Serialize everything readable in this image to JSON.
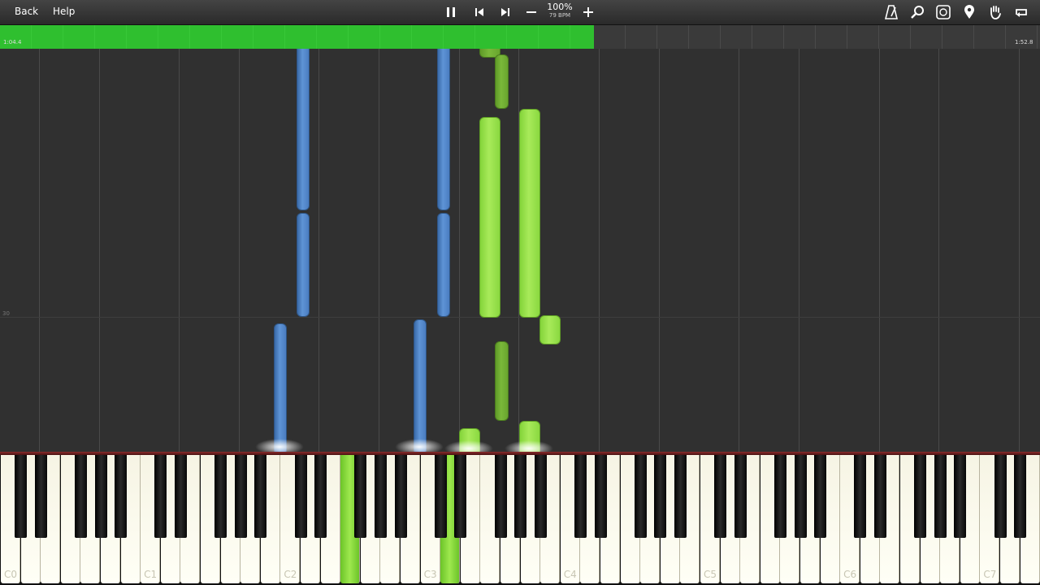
{
  "toolbar": {
    "back_label": "Back",
    "help_label": "Help",
    "zoom": "100%",
    "tempo": "79 BPM",
    "icons": [
      "pause-icon",
      "skip-back-icon",
      "skip-forward-icon",
      "minus-icon",
      "plus-icon",
      "metronome-icon",
      "search-icon",
      "label-icon",
      "location-icon",
      "hand-icon",
      "loop-icon"
    ]
  },
  "progress": {
    "elapsed": "1:04.4",
    "total": "1:52.8",
    "played_fraction": 0.571
  },
  "roll": {
    "measure_label": "30"
  },
  "keyboard": {
    "octave_labels": [
      "C0",
      "C1",
      "C2",
      "C3",
      "C4",
      "C5",
      "C6",
      "C7"
    ]
  },
  "colors": {
    "left_hand": "#4a7cc0",
    "right_hand": "#8ad840",
    "right_hand_dim": "#68a52e",
    "progress": "#2fbf2f"
  }
}
